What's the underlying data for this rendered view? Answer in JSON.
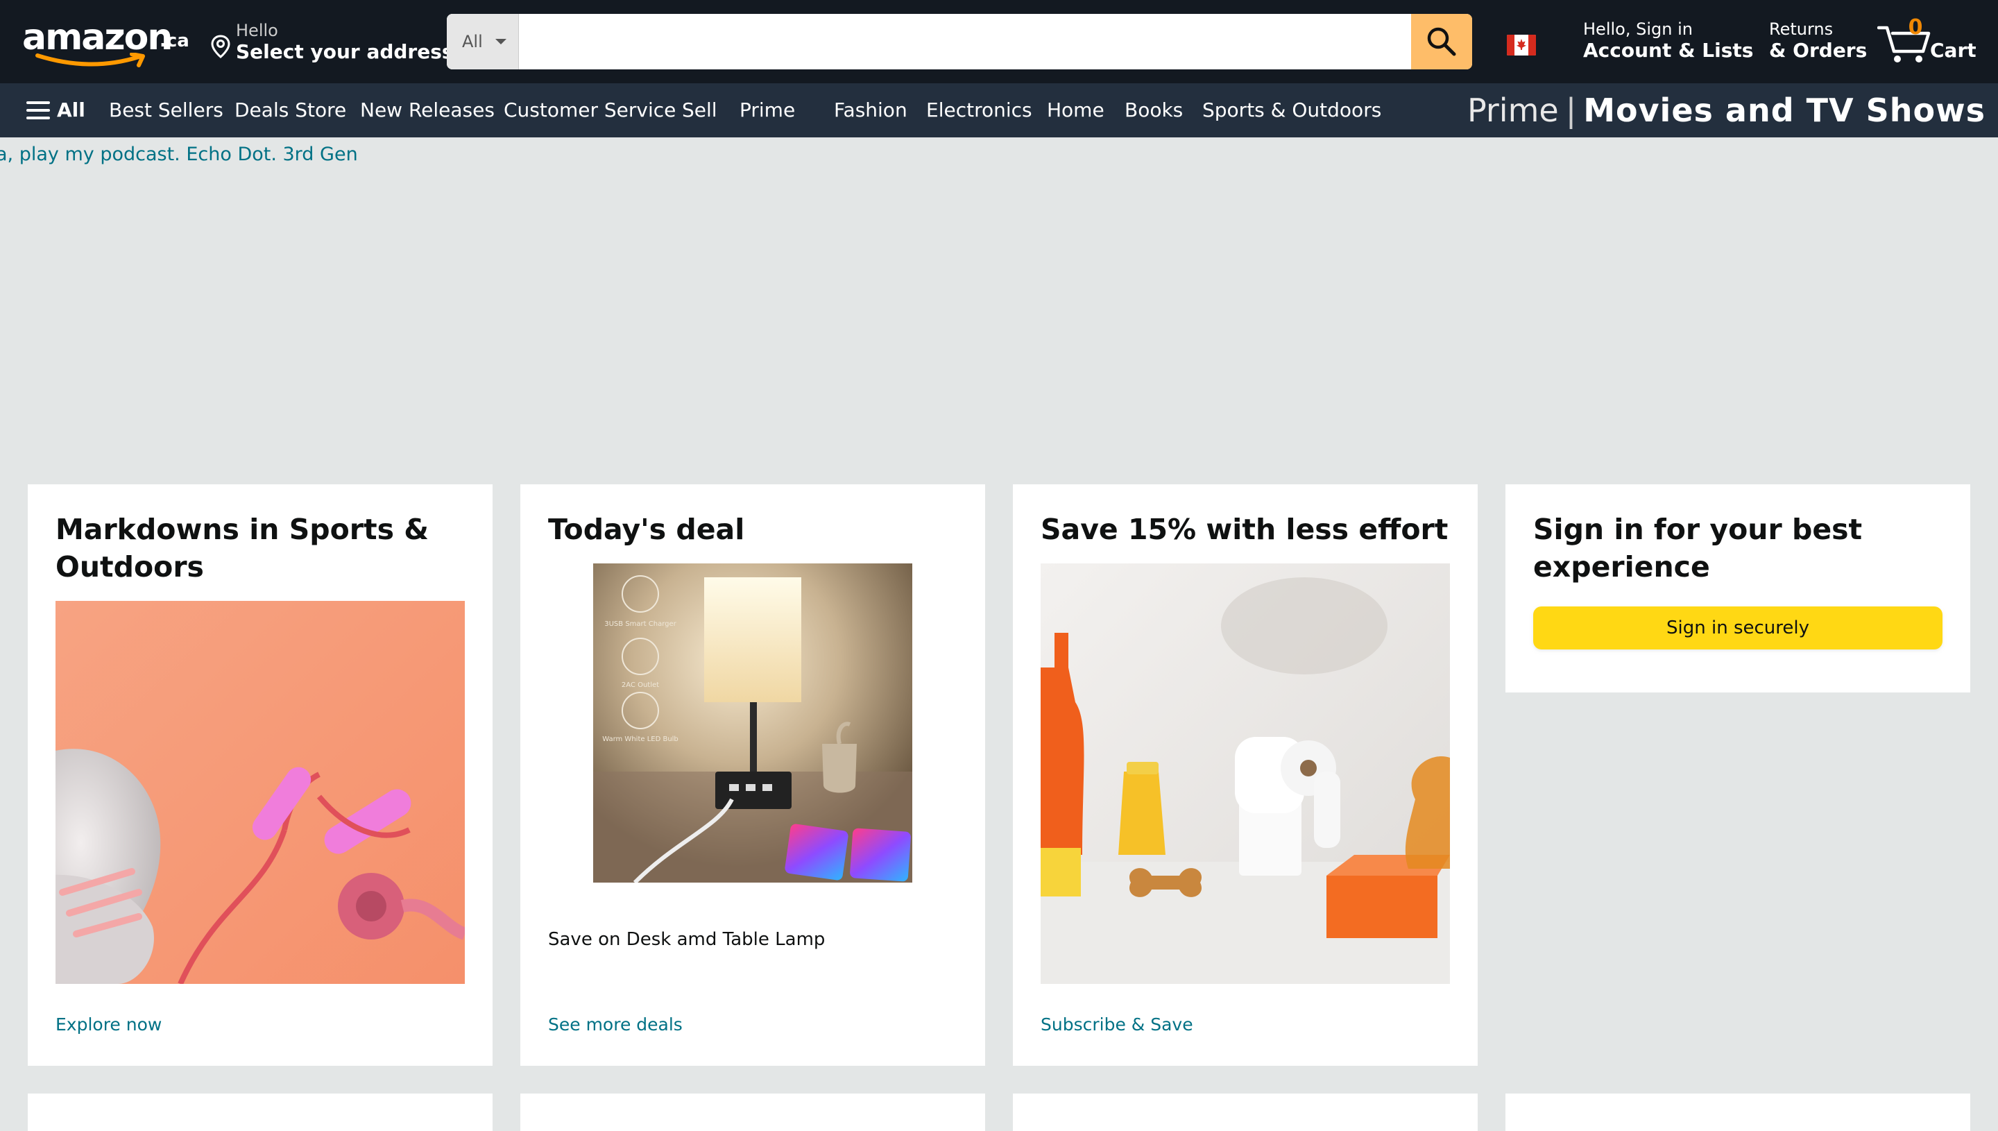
{
  "header": {
    "logo_text": "amazon",
    "logo_tld": ".ca",
    "address_greeting": "Hello",
    "address_label": "Select your address",
    "search": {
      "category": "All",
      "placeholder": "",
      "value": ""
    },
    "account_greeting": "Hello, Sign in",
    "account_label": "Account & Lists",
    "returns_top": "Returns",
    "returns_bottom": "& Orders",
    "cart_count": "0",
    "cart_label": "Cart"
  },
  "subnav": {
    "all_label": "All",
    "links": [
      "Best Sellers",
      "Deals Store",
      "New Releases",
      "Customer Service",
      "Sell",
      "Prime",
      "Fashion",
      "Electronics",
      "Home",
      "Books",
      "Sports & Outdoors"
    ],
    "promo_prime": "Prime",
    "promo_separator": "|",
    "promo_title": "Movies and TV Shows"
  },
  "ticker_text": "a, play my podcast. Echo Dot. 3rd Gen",
  "cards": [
    {
      "title": "Markdowns in Sports & Outdoors",
      "link": "Explore now"
    },
    {
      "title": "Today's deal",
      "caption": "Save on Desk amd Table Lamp",
      "link": "See more deals",
      "lamp_icon_labels": [
        "3USB Smart Charger",
        "2AC Outlet",
        "Warm White LED Bulb"
      ]
    },
    {
      "title": "Save 15% with less effort",
      "link": "Subscribe & Save"
    },
    {
      "title": "Sign in for your best experience",
      "button": "Sign in securely"
    }
  ],
  "colors": {
    "nav_bg": "#131921",
    "subnav_bg": "#232f3e",
    "search_button": "#febd69",
    "cart_count": "#f08804",
    "link": "#007185",
    "signin_button": "#ffd814",
    "page_bg": "#e3e6e6"
  }
}
